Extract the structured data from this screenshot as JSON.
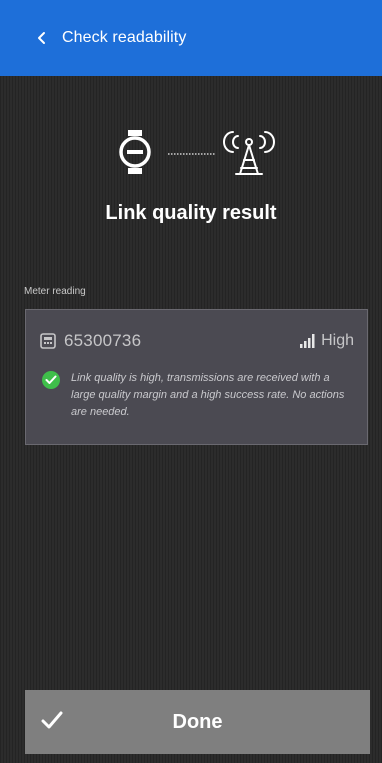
{
  "header": {
    "title": "Check readability",
    "background": "#1e6fd9",
    "back_icon": "chevron-left-icon"
  },
  "illustration": {
    "left_icon": "meter-icon",
    "right_icon": "radio-antenna-icon"
  },
  "result": {
    "title": "Link quality result"
  },
  "meter_section": {
    "label": "Meter reading",
    "meter_id": "65300736",
    "quality": "High",
    "quality_icon": "signal-bars-icon",
    "status_icon": "check-circle-icon",
    "status_color": "#3fbf4a",
    "message": "Link quality is high, transmissions are received with a large quality margin and a high success rate. No actions are needed."
  },
  "footer": {
    "done_label": "Done",
    "done_icon": "check-icon"
  }
}
